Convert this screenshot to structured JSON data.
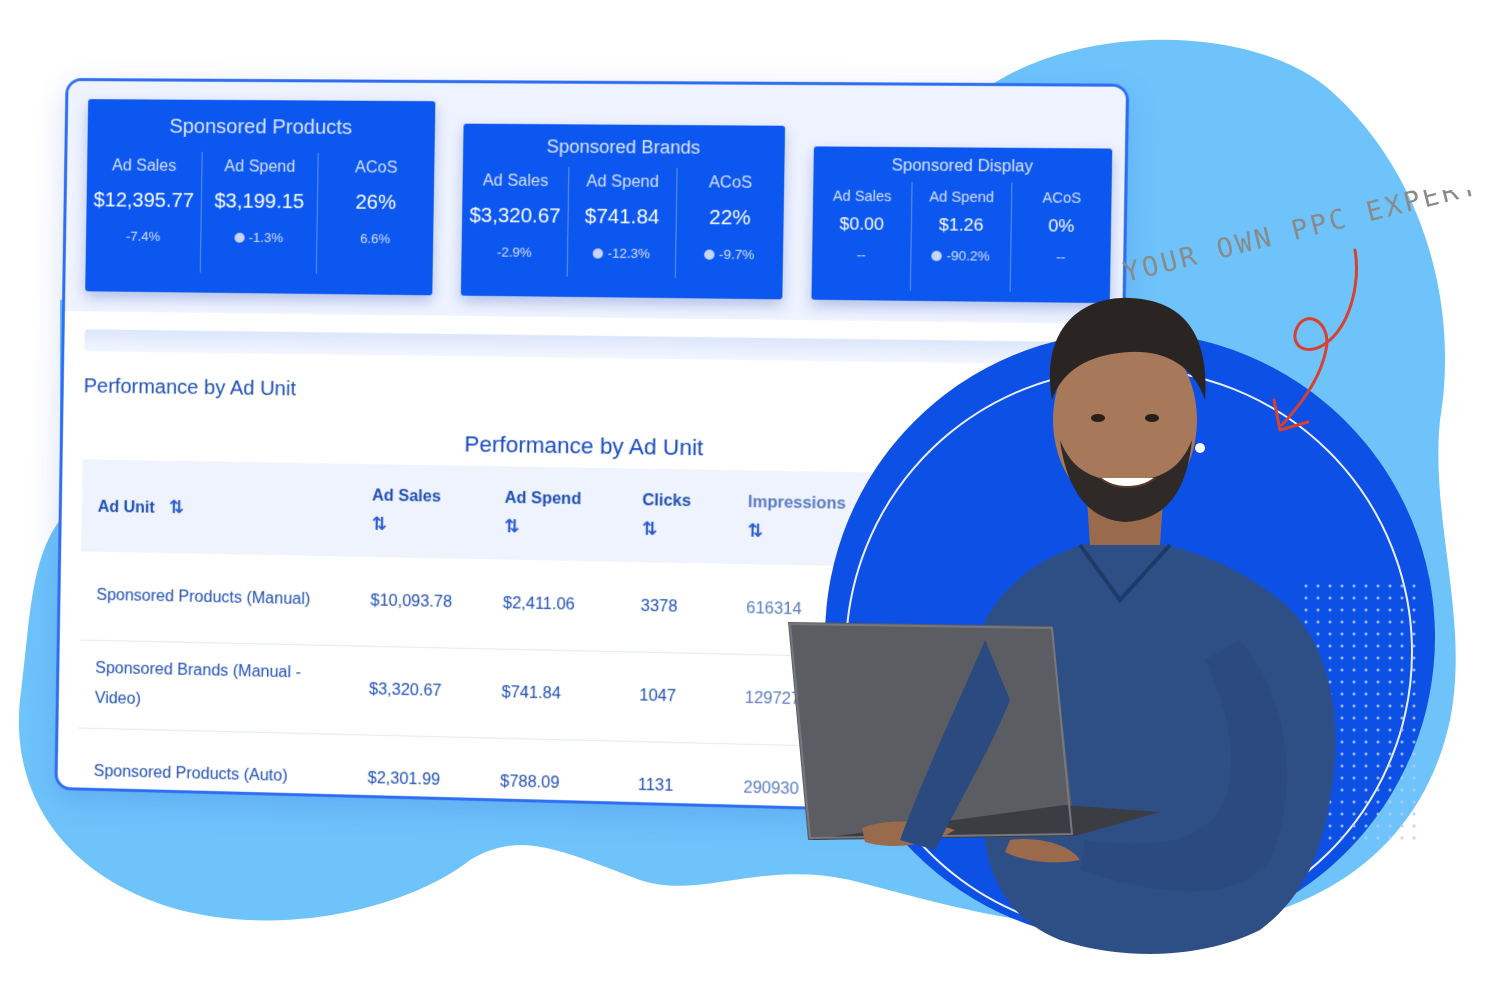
{
  "kpi_cards": [
    {
      "title": "Sponsored Products",
      "metrics": [
        {
          "label": "Ad Sales",
          "value": "$12,395.77",
          "change": "-7.4%"
        },
        {
          "label": "Ad Spend",
          "value": "$3,199.15",
          "change": "-1.3%"
        },
        {
          "label": "ACoS",
          "value": "26%",
          "change": "6.6%"
        }
      ]
    },
    {
      "title": "Sponsored Brands",
      "metrics": [
        {
          "label": "Ad Sales",
          "value": "$3,320.67",
          "change": "-2.9%"
        },
        {
          "label": "Ad Spend",
          "value": "$741.84",
          "change": "-12.3%"
        },
        {
          "label": "ACoS",
          "value": "22%",
          "change": "-9.7%"
        }
      ]
    },
    {
      "title": "Sponsored Display",
      "metrics": [
        {
          "label": "Ad Sales",
          "value": "$0.00",
          "change": "--"
        },
        {
          "label": "Ad Spend",
          "value": "$1.26",
          "change": "-90.2%"
        },
        {
          "label": "ACoS",
          "value": "0%",
          "change": "--"
        }
      ]
    }
  ],
  "section_title": "Performance by Ad Unit",
  "table": {
    "title": "Performance by Ad Unit",
    "sort_glyph": "⇅",
    "columns": [
      "Ad Unit",
      "Ad Sales",
      "Ad Spend",
      "Clicks",
      "Impressions"
    ],
    "rows": [
      [
        "Sponsored Products (Manual)",
        "$10,093.78",
        "$2,411.06",
        "3378",
        "616314"
      ],
      [
        "Sponsored Brands (Manual - Video)",
        "$3,320.67",
        "$741.84",
        "1047",
        "129727"
      ],
      [
        "Sponsored Products (Auto)",
        "$2,301.99",
        "$788.09",
        "1131",
        "290930"
      ]
    ]
  },
  "handwritten_note": "YOUR OWN PPC EXPERT",
  "colors": {
    "brand_blue": "#0b57f0",
    "circle_blue": "#0c50e6",
    "blob": "#6ec3fb",
    "text_blue": "#1f4fb4",
    "arrow_red": "#d8412f"
  }
}
